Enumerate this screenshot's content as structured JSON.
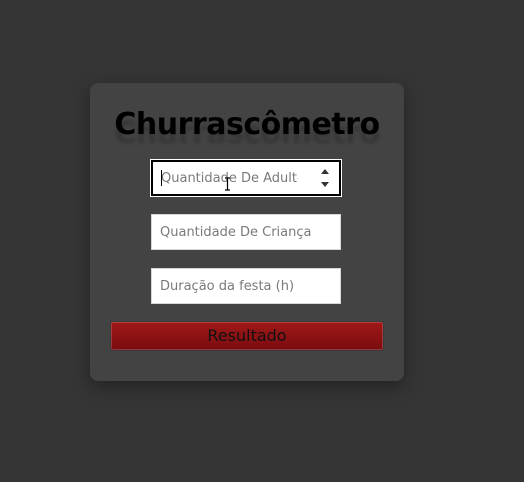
{
  "app": {
    "title": "Churrascômetro"
  },
  "form": {
    "adults_placeholder": "Quantidade De Adultos",
    "adults_value": "",
    "children_placeholder": "Quantidade De Criança",
    "children_value": "",
    "duration_placeholder": "Duração da festa (h)",
    "duration_value": "",
    "submit_label": "Resultado"
  },
  "colors": {
    "page_background": "#353535",
    "card_background": "#434343",
    "button_red": "#8b1116"
  },
  "icons": {
    "spinner": "number-spinner-icon",
    "cursor": "text-cursor-icon"
  }
}
